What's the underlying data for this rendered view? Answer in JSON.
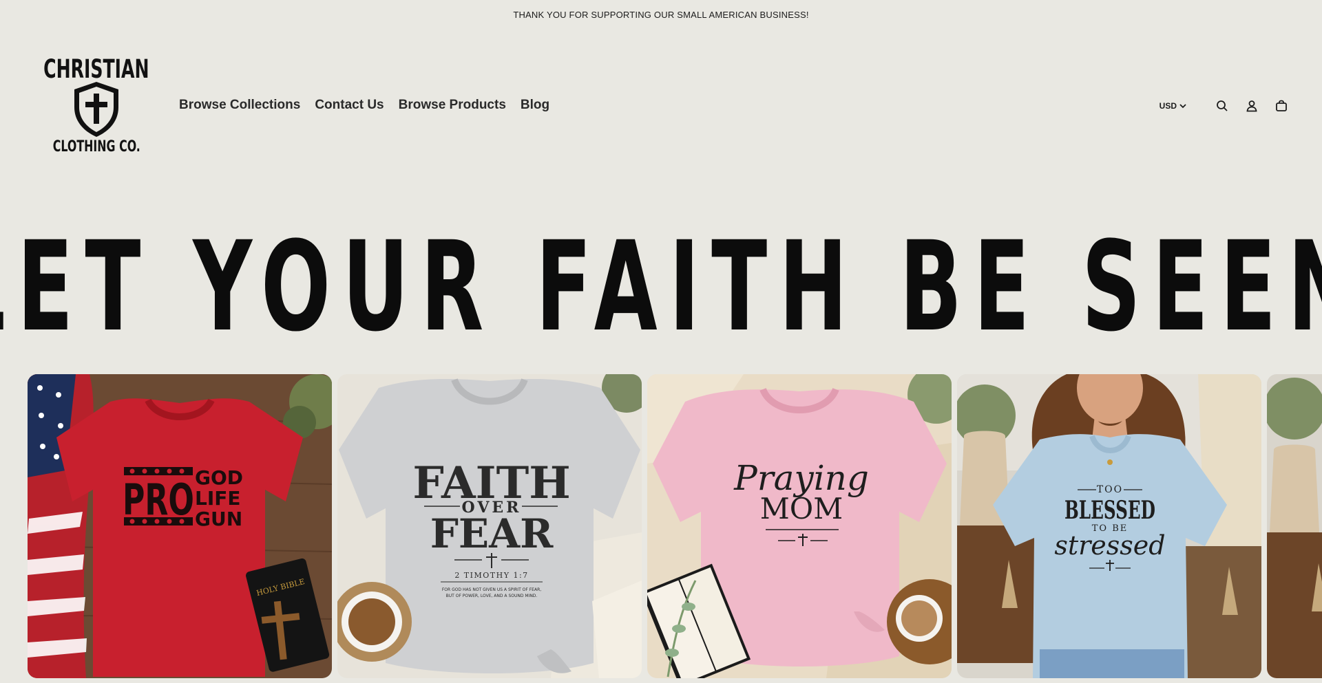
{
  "announcement": {
    "text": "THANK YOU FOR SUPPORTING OUR SMALL AMERICAN BUSINESS!"
  },
  "logo": {
    "line1": "CHRISTIAN",
    "line2": "CLOTHING CO."
  },
  "nav": {
    "items": [
      {
        "label": "Browse Collections"
      },
      {
        "label": "Contact Us"
      },
      {
        "label": "Browse Products"
      },
      {
        "label": "Blog"
      }
    ]
  },
  "header_tools": {
    "currency": "USD",
    "icons": [
      "search-icon",
      "account-icon",
      "cart-icon"
    ]
  },
  "hero": {
    "title": "LET YOUR FAITH BE SEEN"
  },
  "products": [
    {
      "shirt_color": "#c8202e",
      "bg_color": "#6b4a33",
      "design": {
        "big": "PRO",
        "lines": [
          "GOD",
          "LIFE",
          "GUN"
        ]
      },
      "prop_text": "HOLY BIBLE"
    },
    {
      "shirt_color": "#cfd0d2",
      "bg_color": "#e7e3da",
      "design": {
        "line1": "FAITH",
        "line2": "OVER",
        "line3": "FEAR",
        "ref": "2 TIMOTHY 1:7",
        "verse1": "FOR GOD HAS NOT GIVEN US A SPIRIT OF FEAR,",
        "verse2": "BUT OF POWER, LOVE, AND A SOUND MIND."
      }
    },
    {
      "shirt_color": "#f0b9c9",
      "bg_color": "#e9dcc6",
      "design": {
        "line1": "Praying",
        "line2": "MOM"
      }
    },
    {
      "shirt_color": "#b3cde0",
      "bg_color": "#d9d5cc",
      "design": {
        "line1": "TOO",
        "line2": "BLESSED",
        "line3": "TO BE",
        "line4": "stressed"
      }
    }
  ],
  "colors": {
    "background": "#e9e8e2",
    "text": "#121212"
  }
}
